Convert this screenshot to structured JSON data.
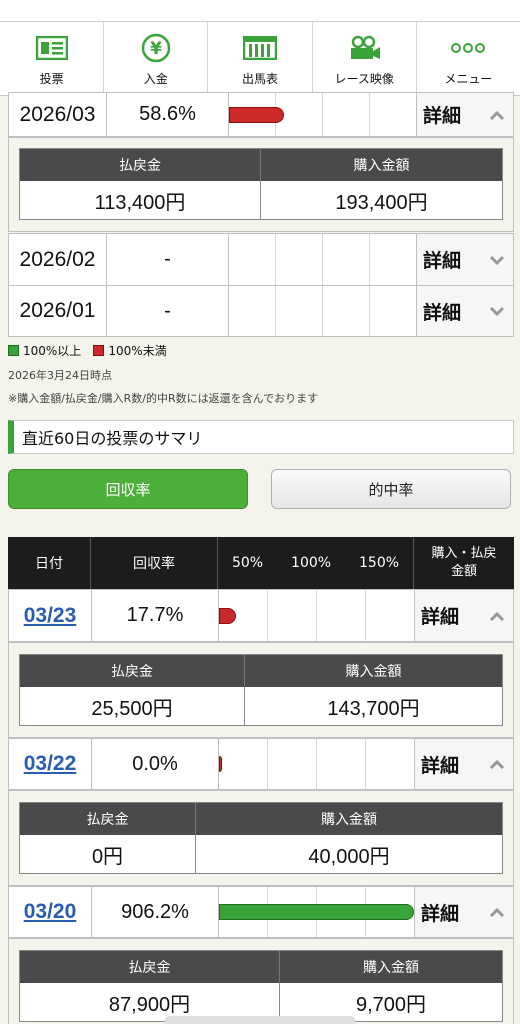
{
  "nav": [
    {
      "label": "投票",
      "icon": "ticket-icon"
    },
    {
      "label": "入金",
      "icon": "yen-icon"
    },
    {
      "label": "出馬表",
      "icon": "racecard-icon"
    },
    {
      "label": "レース映像",
      "icon": "video-camera-icon"
    },
    {
      "label": "メニュー",
      "icon": "menu-dots-icon"
    }
  ],
  "colors": {
    "green": "#3aa33a",
    "red": "#cc2a2a",
    "link": "#2a5db0",
    "header": "#1c1c1c"
  },
  "monthly": [
    {
      "date": "2026/03",
      "rate": "58.6%",
      "rate_value": 58.6,
      "detail": "詳細",
      "expanded": true,
      "payout": "113,400円",
      "purchase": "193,400円"
    },
    {
      "date": "2026/02",
      "rate": "-",
      "detail": "詳細",
      "expanded": false
    },
    {
      "date": "2026/01",
      "rate": "-",
      "detail": "詳細",
      "expanded": false
    }
  ],
  "detail_headers": {
    "payout": "払戻金",
    "purchase": "購入金額"
  },
  "legend": {
    "over": "100%以上",
    "under": "100%未満"
  },
  "timestamp": "2026年3月24日時点",
  "note": "※購入金額/払戻金/購入R数/的中R数には返還を含んでおります",
  "section_title": "直近60日の投票のサマリ",
  "buttons": {
    "recovery": "回収率",
    "hit": "的中率"
  },
  "table_header": {
    "date": "日付",
    "rate": "回収率",
    "p50": "50%",
    "p100": "100%",
    "p150": "150%",
    "purchase": "購入・払戻\n金額"
  },
  "daily": [
    {
      "date": "03/23",
      "rate": "17.7%",
      "rate_value": 17.7,
      "detail": "詳細",
      "payout": "25,500円",
      "purchase": "143,700円"
    },
    {
      "date": "03/22",
      "rate": "0.0%",
      "rate_value": 0.0,
      "detail": "詳細",
      "payout": "0円",
      "purchase": "40,000円"
    },
    {
      "date": "03/20",
      "rate": "906.2%",
      "rate_value": 906.2,
      "detail": "詳細",
      "payout": "87,900円",
      "purchase": "9,700円"
    }
  ]
}
